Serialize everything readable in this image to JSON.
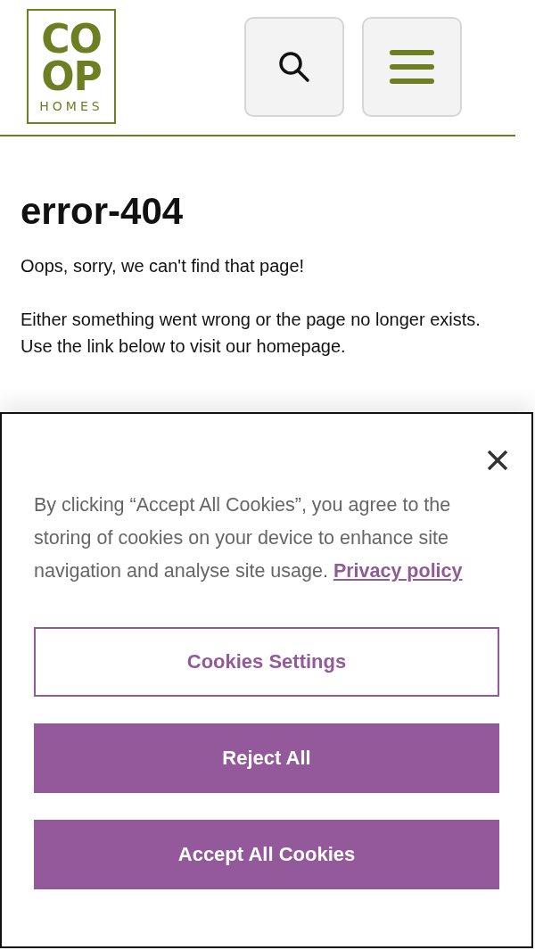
{
  "header": {
    "logo": {
      "lines": [
        "CO",
        "OP",
        "HOMES"
      ]
    },
    "buttons": [
      {
        "kind": "search"
      },
      {
        "kind": "menu"
      }
    ]
  },
  "content": {
    "title": "error-404",
    "paragraphs": [
      "Oops, sorry, we can't find that page!",
      "Either something went wrong or the page no longer exists. Use the link below to visit our homepage."
    ]
  },
  "cookie_banner": {
    "text": "By clicking “Accept All Cookies”, you agree to the storing of cookies on your device to enhance site navigation and analyse site usage.",
    "link": "Privacy policy",
    "buttons": [
      {
        "label": "Cookies Settings",
        "kind": "outline"
      },
      {
        "label": "Reject All",
        "kind": "filled"
      },
      {
        "label": "Accept All Cookies",
        "kind": "filled"
      }
    ]
  }
}
